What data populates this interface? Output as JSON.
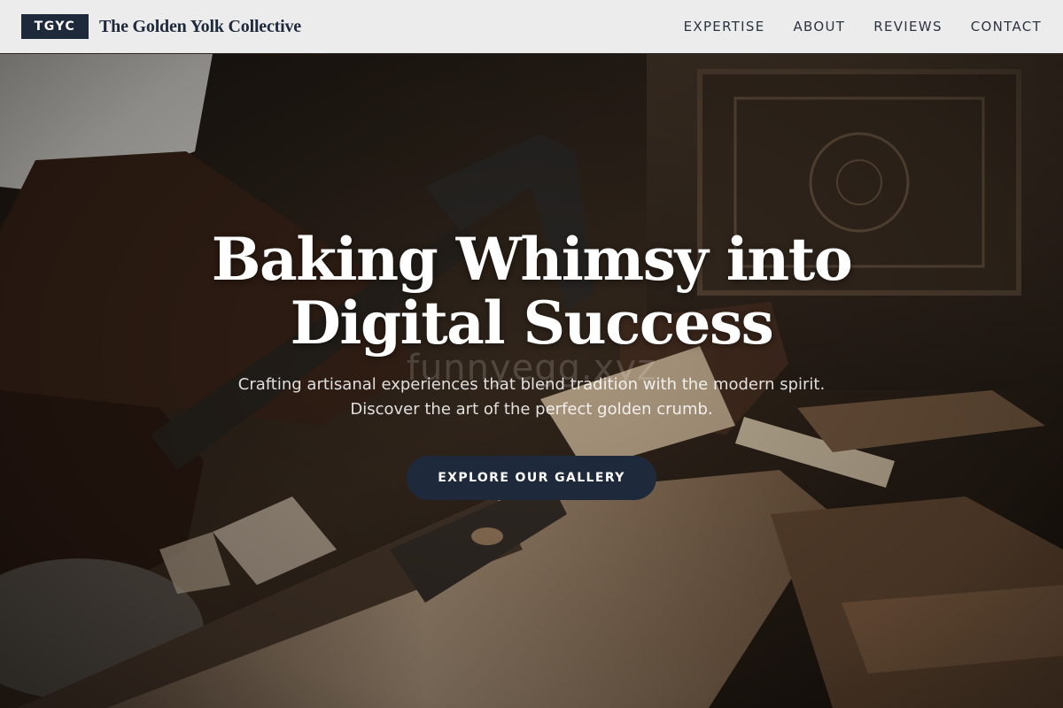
{
  "brand": {
    "logo_text": "TGYC",
    "name": "The Golden Yolk Collective"
  },
  "nav": {
    "items": [
      {
        "label": "EXPERTISE"
      },
      {
        "label": "ABOUT"
      },
      {
        "label": "REVIEWS"
      },
      {
        "label": "CONTACT"
      }
    ]
  },
  "hero": {
    "title": "Baking Whimsy into Digital Success",
    "watermark": "funnyegg.xyz",
    "subtitle": "Crafting artisanal experiences that blend tradition with the modern spirit. Discover the art of the perfect golden crumb.",
    "cta_label": "EXPLORE OUR GALLERY",
    "image_subject": "woodworker-carving-photo"
  },
  "colors": {
    "brand_navy": "#1e2a3c",
    "header_bg": "#ececec",
    "text_light": "#ffffff"
  }
}
